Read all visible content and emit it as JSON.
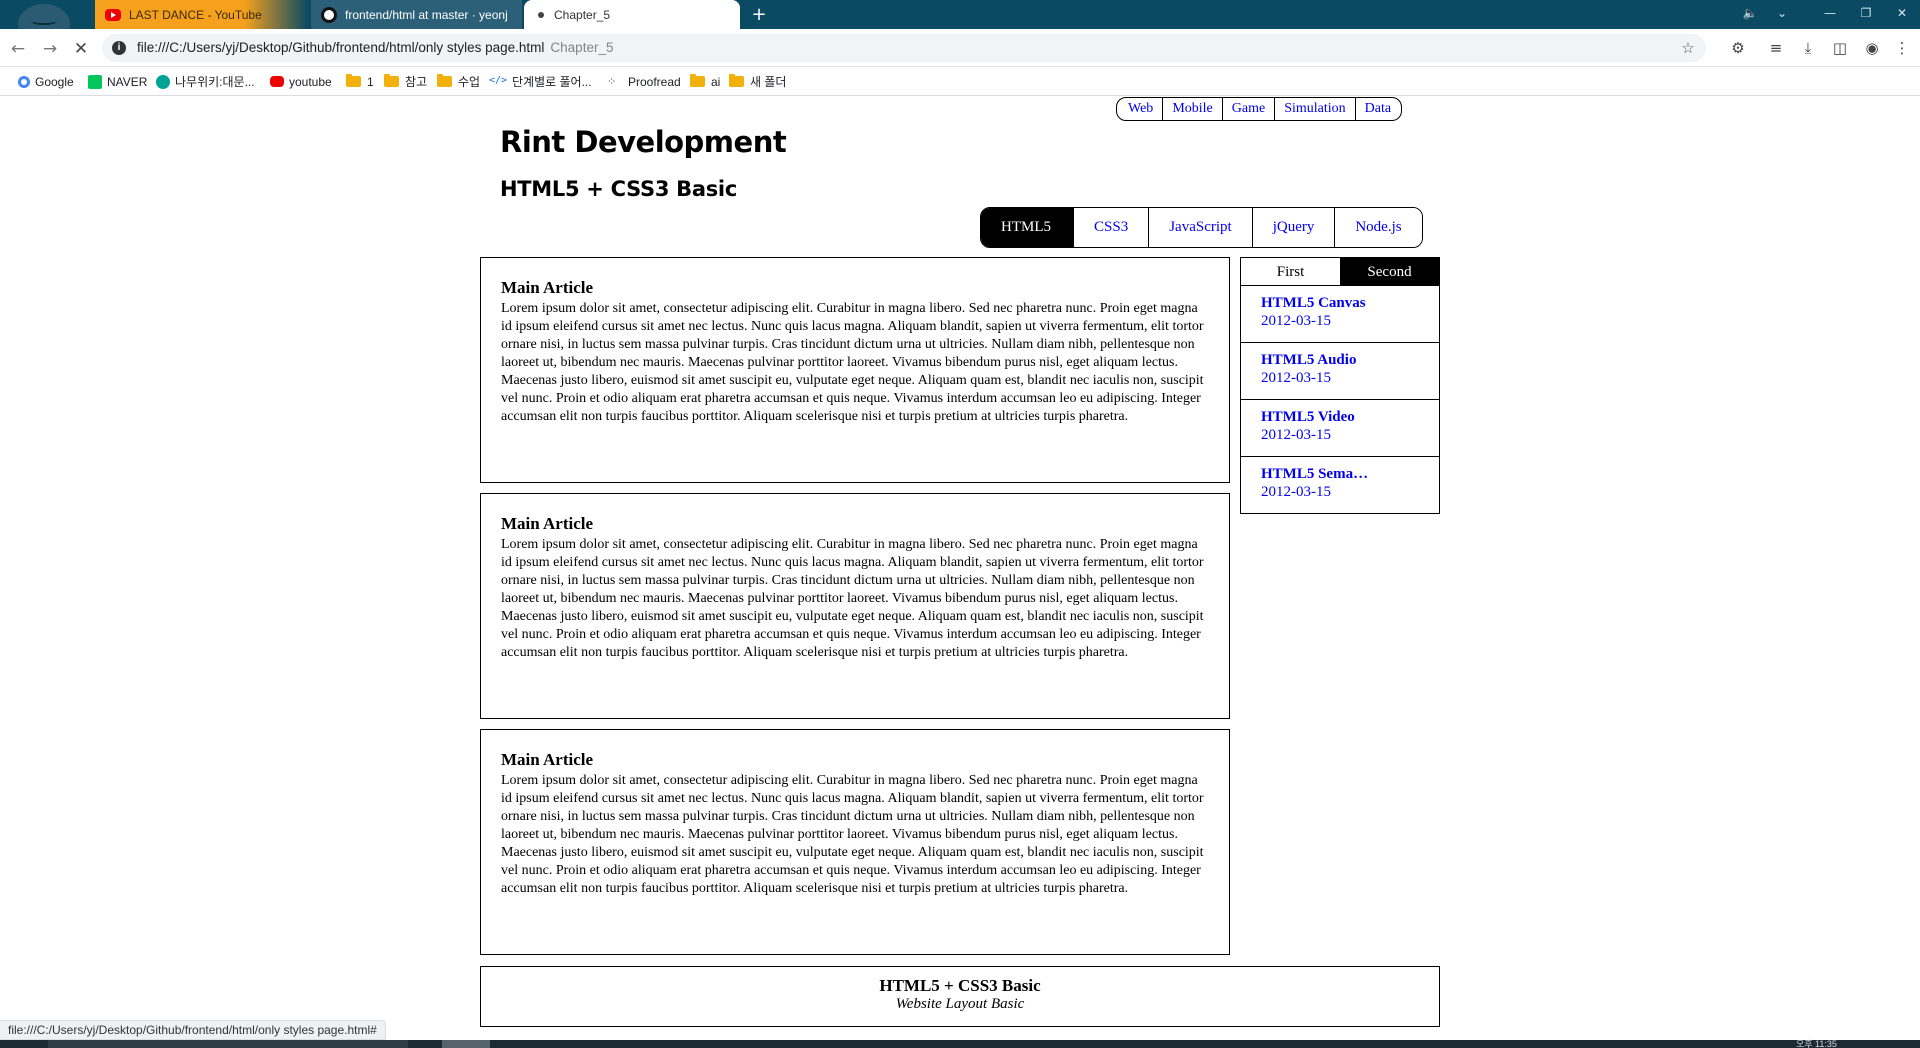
{
  "browser": {
    "tabs": [
      {
        "title": "LAST DANCE - YouTube",
        "favicon": "youtube-icon"
      },
      {
        "title": "frontend/html at master · yeonj",
        "favicon": "github-icon"
      },
      {
        "title": "Chapter_5",
        "favicon": "loading-dot-icon"
      }
    ],
    "new_tab": "+",
    "url": "file:///C:/Users/yj/Desktop/Github/frontend/html/only styles page.html",
    "url_hint": "Chapter_5",
    "bookmarks": [
      {
        "label": "Google",
        "icon": "google-icon"
      },
      {
        "label": "NAVER",
        "icon": "naver-icon"
      },
      {
        "label": "나무위키:대문...",
        "icon": "namuwiki-icon"
      },
      {
        "label": "youtube",
        "icon": "youtube-icon"
      },
      {
        "label": "1",
        "icon": "folder-icon"
      },
      {
        "label": "참고",
        "icon": "folder-icon"
      },
      {
        "label": "수업",
        "icon": "folder-icon"
      },
      {
        "label": "단계별로 풀어...",
        "icon": "code-icon"
      },
      {
        "label": "Proofread",
        "icon": "proofread-icon"
      },
      {
        "label": "ai",
        "icon": "folder-icon"
      },
      {
        "label": "새 폴더",
        "icon": "folder-icon"
      }
    ],
    "status_url": "file:///C:/Users/yj/Desktop/Github/frontend/html/only styles page.html#",
    "clock": "오후 11:35"
  },
  "page": {
    "top_nav": [
      "Web",
      "Mobile",
      "Game",
      "Simulation",
      "Data"
    ],
    "title": "Rint Development",
    "subtitle": "HTML5 + CSS3 Basic",
    "main_nav": [
      "HTML5",
      "CSS3",
      "JavaScript",
      "jQuery",
      "Node.js"
    ],
    "main_nav_active": "HTML5",
    "articles": [
      {
        "heading": "Main Article",
        "body": "Lorem ipsum dolor sit amet, consectetur adipiscing elit. Curabitur in magna libero. Sed nec pharetra nunc. Proin eget magna id ipsum eleifend cursus sit amet nec lectus. Nunc quis lacus magna. Aliquam blandit, sapien ut viverra fermentum, elit tortor ornare nisi, in luctus sem massa pulvinar turpis. Cras tincidunt dictum urna ut ultricies. Nullam diam nibh, pellentesque non laoreet ut, bibendum nec mauris. Maecenas pulvinar porttitor laoreet. Vivamus bibendum purus nisl, eget aliquam lectus. Maecenas justo libero, euismod sit amet suscipit eu, vulputate eget neque. Aliquam quam est, blandit nec iaculis non, suscipit vel nunc. Proin et odio aliquam erat pharetra accumsan et quis neque. Vivamus interdum accumsan leo eu adipiscing. Integer accumsan elit non turpis faucibus porttitor. Aliquam scelerisque nisi et turpis pretium at ultricies turpis pharetra."
      },
      {
        "heading": "Main Article",
        "body": "Lorem ipsum dolor sit amet, consectetur adipiscing elit. Curabitur in magna libero. Sed nec pharetra nunc. Proin eget magna id ipsum eleifend cursus sit amet nec lectus. Nunc quis lacus magna. Aliquam blandit, sapien ut viverra fermentum, elit tortor ornare nisi, in luctus sem massa pulvinar turpis. Cras tincidunt dictum urna ut ultricies. Nullam diam nibh, pellentesque non laoreet ut, bibendum nec mauris. Maecenas pulvinar porttitor laoreet. Vivamus bibendum purus nisl, eget aliquam lectus. Maecenas justo libero, euismod sit amet suscipit eu, vulputate eget neque. Aliquam quam est, blandit nec iaculis non, suscipit vel nunc. Proin et odio aliquam erat pharetra accumsan et quis neque. Vivamus interdum accumsan leo eu adipiscing. Integer accumsan elit non turpis faucibus porttitor. Aliquam scelerisque nisi et turpis pretium at ultricies turpis pharetra."
      },
      {
        "heading": "Main Article",
        "body": "Lorem ipsum dolor sit amet, consectetur adipiscing elit. Curabitur in magna libero. Sed nec pharetra nunc. Proin eget magna id ipsum eleifend cursus sit amet nec lectus. Nunc quis lacus magna. Aliquam blandit, sapien ut viverra fermentum, elit tortor ornare nisi, in luctus sem massa pulvinar turpis. Cras tincidunt dictum urna ut ultricies. Nullam diam nibh, pellentesque non laoreet ut, bibendum nec mauris. Maecenas pulvinar porttitor laoreet. Vivamus bibendum purus nisl, eget aliquam lectus. Maecenas justo libero, euismod sit amet suscipit eu, vulputate eget neque. Aliquam quam est, blandit nec iaculis non, suscipit vel nunc. Proin et odio aliquam erat pharetra accumsan et quis neque. Vivamus interdum accumsan leo eu adipiscing. Integer accumsan elit non turpis faucibus porttitor. Aliquam scelerisque nisi et turpis pretium at ultricies turpis pharetra."
      }
    ],
    "aside": {
      "tabs": [
        "First",
        "Second"
      ],
      "active_tab": "Second",
      "items": [
        {
          "title": "HTML5 Canvas",
          "date": "2012-03-15"
        },
        {
          "title": "HTML5 Audio",
          "date": "2012-03-15"
        },
        {
          "title": "HTML5 Video",
          "date": "2012-03-15"
        },
        {
          "title": "HTML5 Sema…",
          "date": "2012-03-15"
        }
      ]
    },
    "footer": {
      "title": "HTML5 + CSS3 Basic",
      "subtitle": "Website Layout Basic"
    }
  },
  "colors": {
    "tabstrip": "#0b4a63",
    "link": "#0000ee",
    "active_nav_bg": "#000000"
  }
}
